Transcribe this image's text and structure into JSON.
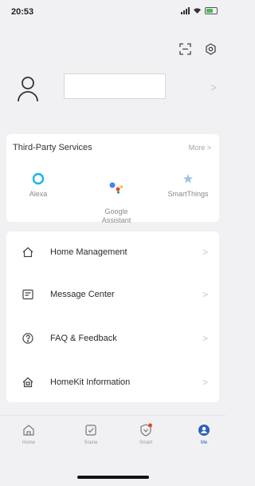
{
  "status_bar": {
    "time": "20:53"
  },
  "third_party": {
    "title": "Third-Party Services",
    "more": "More >",
    "services": [
      {
        "label": "Alexa",
        "icon": "alexa-icon"
      },
      {
        "label": "Google\nAssistant",
        "icon": "google-assistant-icon"
      },
      {
        "label": "SmartThings",
        "icon": "smartthings-icon"
      }
    ]
  },
  "menu": {
    "items": [
      {
        "label": "Home Management",
        "icon": "house-icon"
      },
      {
        "label": "Message Center",
        "icon": "message-icon"
      },
      {
        "label": "FAQ & Feedback",
        "icon": "question-icon"
      },
      {
        "label": "HomeKit Information",
        "icon": "homekit-icon"
      }
    ],
    "chevron": ">"
  },
  "profile": {
    "chevron": ">"
  },
  "tabs": [
    {
      "label": "Home"
    },
    {
      "label": "Scene"
    },
    {
      "label": "Smart"
    },
    {
      "label": "Me"
    }
  ],
  "colors": {
    "accent": "#2b5fb9",
    "alexa": "#1ab6e8",
    "notification": "#e8442e"
  }
}
